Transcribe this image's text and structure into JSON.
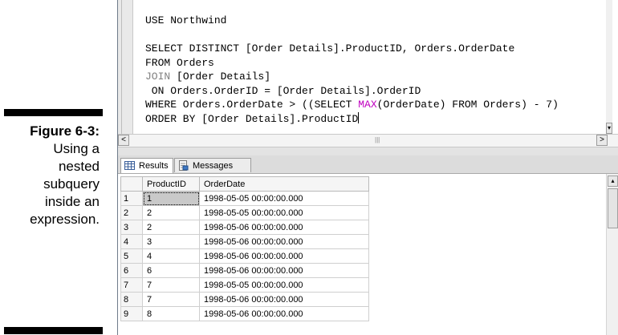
{
  "caption": {
    "figure": "Figure 6-3:",
    "lines": [
      "Using a",
      "nested",
      "subquery",
      "inside an",
      "expression."
    ]
  },
  "editor": {
    "lines": [
      "USE Northwind",
      "",
      "SELECT DISTINCT [Order Details].ProductID, Orders.OrderDate",
      "FROM Orders",
      "JOIN [Order Details]",
      " ON Orders.OrderID = [Order Details].OrderID",
      "WHERE Orders.OrderDate > ((SELECT MAX(OrderDate) FROM Orders) - 7)",
      "ORDER BY [Order Details].ProductID"
    ]
  },
  "tabs": {
    "results": "Results",
    "messages": "Messages"
  },
  "grid": {
    "columns": [
      "ProductID",
      "OrderDate"
    ],
    "rows": [
      {
        "n": "1",
        "pid": "1",
        "date": "1998-05-05 00:00:00.000"
      },
      {
        "n": "2",
        "pid": "2",
        "date": "1998-05-05 00:00:00.000"
      },
      {
        "n": "3",
        "pid": "2",
        "date": "1998-05-06 00:00:00.000"
      },
      {
        "n": "4",
        "pid": "3",
        "date": "1998-05-06 00:00:00.000"
      },
      {
        "n": "5",
        "pid": "4",
        "date": "1998-05-06 00:00:00.000"
      },
      {
        "n": "6",
        "pid": "6",
        "date": "1998-05-06 00:00:00.000"
      },
      {
        "n": "7",
        "pid": "7",
        "date": "1998-05-05 00:00:00.000"
      },
      {
        "n": "8",
        "pid": "7",
        "date": "1998-05-06 00:00:00.000"
      },
      {
        "n": "9",
        "pid": "8",
        "date": "1998-05-06 00:00:00.000"
      }
    ]
  },
  "colors": {
    "keyword_gray": "#808080",
    "function_magenta": "#c000c0",
    "selected_cell": "#c9c9c9"
  }
}
